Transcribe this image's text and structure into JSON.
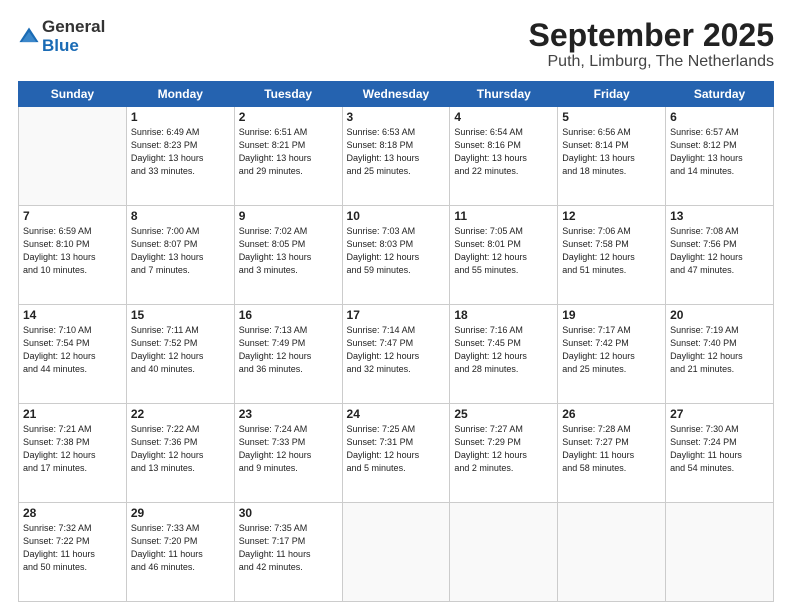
{
  "logo": {
    "general": "General",
    "blue": "Blue"
  },
  "title": "September 2025",
  "location": "Puth, Limburg, The Netherlands",
  "days_header": [
    "Sunday",
    "Monday",
    "Tuesday",
    "Wednesday",
    "Thursday",
    "Friday",
    "Saturday"
  ],
  "weeks": [
    [
      {
        "day": "",
        "info": ""
      },
      {
        "day": "1",
        "info": "Sunrise: 6:49 AM\nSunset: 8:23 PM\nDaylight: 13 hours\nand 33 minutes."
      },
      {
        "day": "2",
        "info": "Sunrise: 6:51 AM\nSunset: 8:21 PM\nDaylight: 13 hours\nand 29 minutes."
      },
      {
        "day": "3",
        "info": "Sunrise: 6:53 AM\nSunset: 8:18 PM\nDaylight: 13 hours\nand 25 minutes."
      },
      {
        "day": "4",
        "info": "Sunrise: 6:54 AM\nSunset: 8:16 PM\nDaylight: 13 hours\nand 22 minutes."
      },
      {
        "day": "5",
        "info": "Sunrise: 6:56 AM\nSunset: 8:14 PM\nDaylight: 13 hours\nand 18 minutes."
      },
      {
        "day": "6",
        "info": "Sunrise: 6:57 AM\nSunset: 8:12 PM\nDaylight: 13 hours\nand 14 minutes."
      }
    ],
    [
      {
        "day": "7",
        "info": "Sunrise: 6:59 AM\nSunset: 8:10 PM\nDaylight: 13 hours\nand 10 minutes."
      },
      {
        "day": "8",
        "info": "Sunrise: 7:00 AM\nSunset: 8:07 PM\nDaylight: 13 hours\nand 7 minutes."
      },
      {
        "day": "9",
        "info": "Sunrise: 7:02 AM\nSunset: 8:05 PM\nDaylight: 13 hours\nand 3 minutes."
      },
      {
        "day": "10",
        "info": "Sunrise: 7:03 AM\nSunset: 8:03 PM\nDaylight: 12 hours\nand 59 minutes."
      },
      {
        "day": "11",
        "info": "Sunrise: 7:05 AM\nSunset: 8:01 PM\nDaylight: 12 hours\nand 55 minutes."
      },
      {
        "day": "12",
        "info": "Sunrise: 7:06 AM\nSunset: 7:58 PM\nDaylight: 12 hours\nand 51 minutes."
      },
      {
        "day": "13",
        "info": "Sunrise: 7:08 AM\nSunset: 7:56 PM\nDaylight: 12 hours\nand 47 minutes."
      }
    ],
    [
      {
        "day": "14",
        "info": "Sunrise: 7:10 AM\nSunset: 7:54 PM\nDaylight: 12 hours\nand 44 minutes."
      },
      {
        "day": "15",
        "info": "Sunrise: 7:11 AM\nSunset: 7:52 PM\nDaylight: 12 hours\nand 40 minutes."
      },
      {
        "day": "16",
        "info": "Sunrise: 7:13 AM\nSunset: 7:49 PM\nDaylight: 12 hours\nand 36 minutes."
      },
      {
        "day": "17",
        "info": "Sunrise: 7:14 AM\nSunset: 7:47 PM\nDaylight: 12 hours\nand 32 minutes."
      },
      {
        "day": "18",
        "info": "Sunrise: 7:16 AM\nSunset: 7:45 PM\nDaylight: 12 hours\nand 28 minutes."
      },
      {
        "day": "19",
        "info": "Sunrise: 7:17 AM\nSunset: 7:42 PM\nDaylight: 12 hours\nand 25 minutes."
      },
      {
        "day": "20",
        "info": "Sunrise: 7:19 AM\nSunset: 7:40 PM\nDaylight: 12 hours\nand 21 minutes."
      }
    ],
    [
      {
        "day": "21",
        "info": "Sunrise: 7:21 AM\nSunset: 7:38 PM\nDaylight: 12 hours\nand 17 minutes."
      },
      {
        "day": "22",
        "info": "Sunrise: 7:22 AM\nSunset: 7:36 PM\nDaylight: 12 hours\nand 13 minutes."
      },
      {
        "day": "23",
        "info": "Sunrise: 7:24 AM\nSunset: 7:33 PM\nDaylight: 12 hours\nand 9 minutes."
      },
      {
        "day": "24",
        "info": "Sunrise: 7:25 AM\nSunset: 7:31 PM\nDaylight: 12 hours\nand 5 minutes."
      },
      {
        "day": "25",
        "info": "Sunrise: 7:27 AM\nSunset: 7:29 PM\nDaylight: 12 hours\nand 2 minutes."
      },
      {
        "day": "26",
        "info": "Sunrise: 7:28 AM\nSunset: 7:27 PM\nDaylight: 11 hours\nand 58 minutes."
      },
      {
        "day": "27",
        "info": "Sunrise: 7:30 AM\nSunset: 7:24 PM\nDaylight: 11 hours\nand 54 minutes."
      }
    ],
    [
      {
        "day": "28",
        "info": "Sunrise: 7:32 AM\nSunset: 7:22 PM\nDaylight: 11 hours\nand 50 minutes."
      },
      {
        "day": "29",
        "info": "Sunrise: 7:33 AM\nSunset: 7:20 PM\nDaylight: 11 hours\nand 46 minutes."
      },
      {
        "day": "30",
        "info": "Sunrise: 7:35 AM\nSunset: 7:17 PM\nDaylight: 11 hours\nand 42 minutes."
      },
      {
        "day": "",
        "info": ""
      },
      {
        "day": "",
        "info": ""
      },
      {
        "day": "",
        "info": ""
      },
      {
        "day": "",
        "info": ""
      }
    ]
  ]
}
